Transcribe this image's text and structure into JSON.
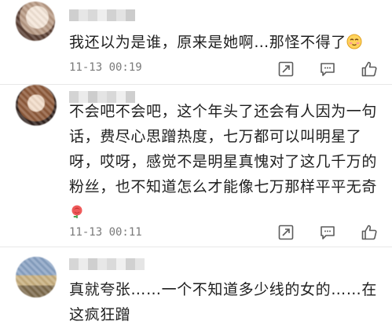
{
  "comments": [
    {
      "text": "我还以为是谁，原来是她啊…那怪不得了",
      "emoji": "shy-smile-emoji",
      "time": "11-13 00:19",
      "avatar_colors": [
        "#6a4e3e",
        "#e9d7c7"
      ]
    },
    {
      "text": "不会吧不会吧，这个年头了还会有人因为一句话，费尽心思蹭热度，七万都可以叫明星了呀，哎呀，感觉不是明星真愧对了这几千万的粉丝，也不知道怎么才能像七万那样平平无奇",
      "emoji": "rose-emoji",
      "time": "11-13 00:11",
      "avatar_colors": [
        "#a7724e",
        "#3b2a22"
      ]
    },
    {
      "text": "真就夸张……一个不知道多少线的女的……在这疯狂蹭",
      "emoji": "",
      "time": "",
      "avatar_colors": [
        "#6c83a6",
        "#d7c29b"
      ]
    }
  ],
  "icons": {
    "share": "share-icon",
    "comment": "comment-icon",
    "like": "thumbs-up-icon"
  },
  "colors": {
    "text": "#1f1f1f",
    "meta": "#7a7a7a",
    "icon": "#5b5b5b"
  }
}
